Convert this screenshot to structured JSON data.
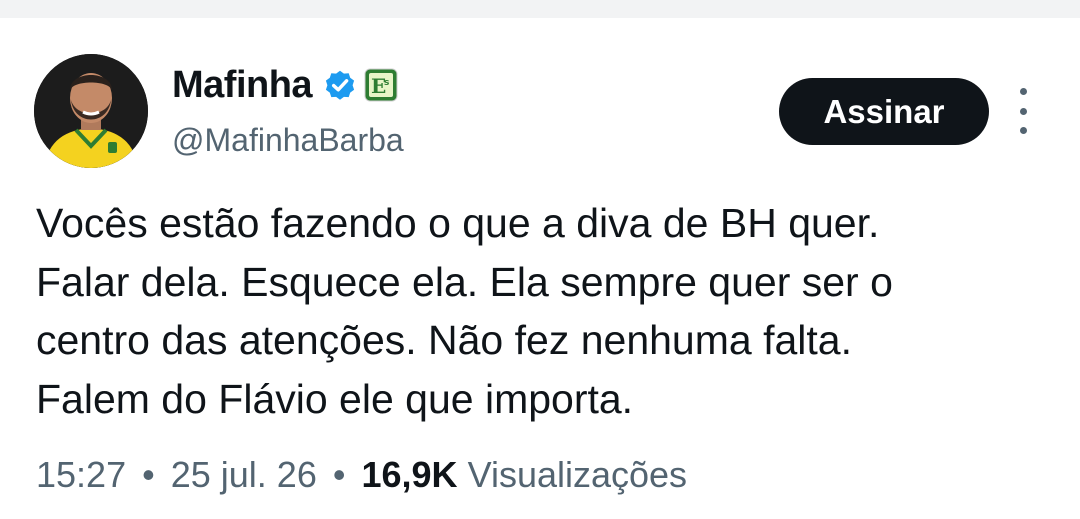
{
  "author": {
    "name": "Mafinha",
    "handle": "@MafinhaBarba",
    "verified": true,
    "affiliate_badge": "Es"
  },
  "actions": {
    "subscribe_label": "Assinar",
    "more_icon": "more-vertical-icon"
  },
  "tweet": {
    "lines": [
      "Vocês estão fazendo o que a diva de BH quer.",
      "Falar dela. Esquece ela. Ela sempre quer ser o",
      "centro das atenções. Não fez nenhuma falta.",
      "Falem do Flávio ele que importa."
    ]
  },
  "meta": {
    "time": "15:27",
    "date": "25 jul. 26",
    "separator": "•",
    "views_count": "16,9K",
    "views_label": "Visualizações"
  },
  "colors": {
    "text": "#0f1419",
    "secondary": "#536471",
    "verified": "#1d9bf0",
    "badge_green": "#2e7d32"
  }
}
